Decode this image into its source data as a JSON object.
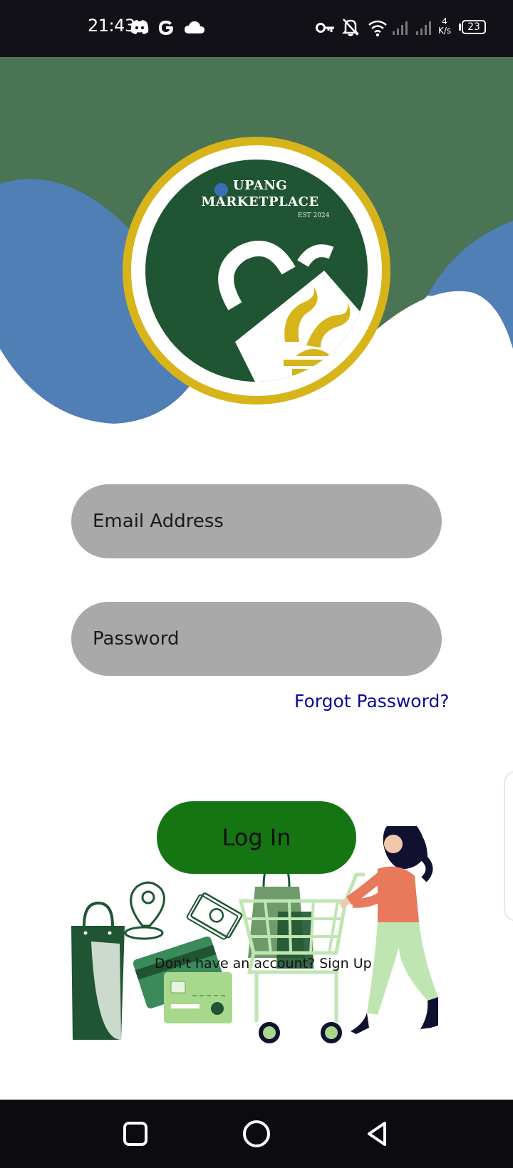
{
  "status_bar": {
    "time": "21:43",
    "net_speed_value": "4",
    "net_speed_unit": "K/s",
    "battery_level": "23",
    "icons": [
      "discord-icon",
      "google-icon",
      "cloud-icon",
      "vpn-key-icon",
      "notifications-off-icon",
      "wifi-icon",
      "signal-icon",
      "signal-icon"
    ]
  },
  "logo": {
    "line1": "UPANG",
    "line2": "MARKETPLACE",
    "est": "EST 2024"
  },
  "form": {
    "email_placeholder": "Email Address",
    "password_placeholder": "Password",
    "forgot_label": "Forgot Password?",
    "login_label": "Log In",
    "signup_prompt": "Don't have an account?",
    "signup_label": "Sign Up"
  },
  "colors": {
    "header_green": "#4a7454",
    "header_blue": "#4f7fb4",
    "logo_dark_green": "#1f5532",
    "logo_ring_gold": "#d6b41a",
    "input_gray": "#a9a9a9",
    "login_green": "#157513",
    "link_blue": "#0a0a9c"
  },
  "nav_bar": {
    "icons": [
      "recents-square-icon",
      "home-circle-icon",
      "back-triangle-icon"
    ]
  }
}
